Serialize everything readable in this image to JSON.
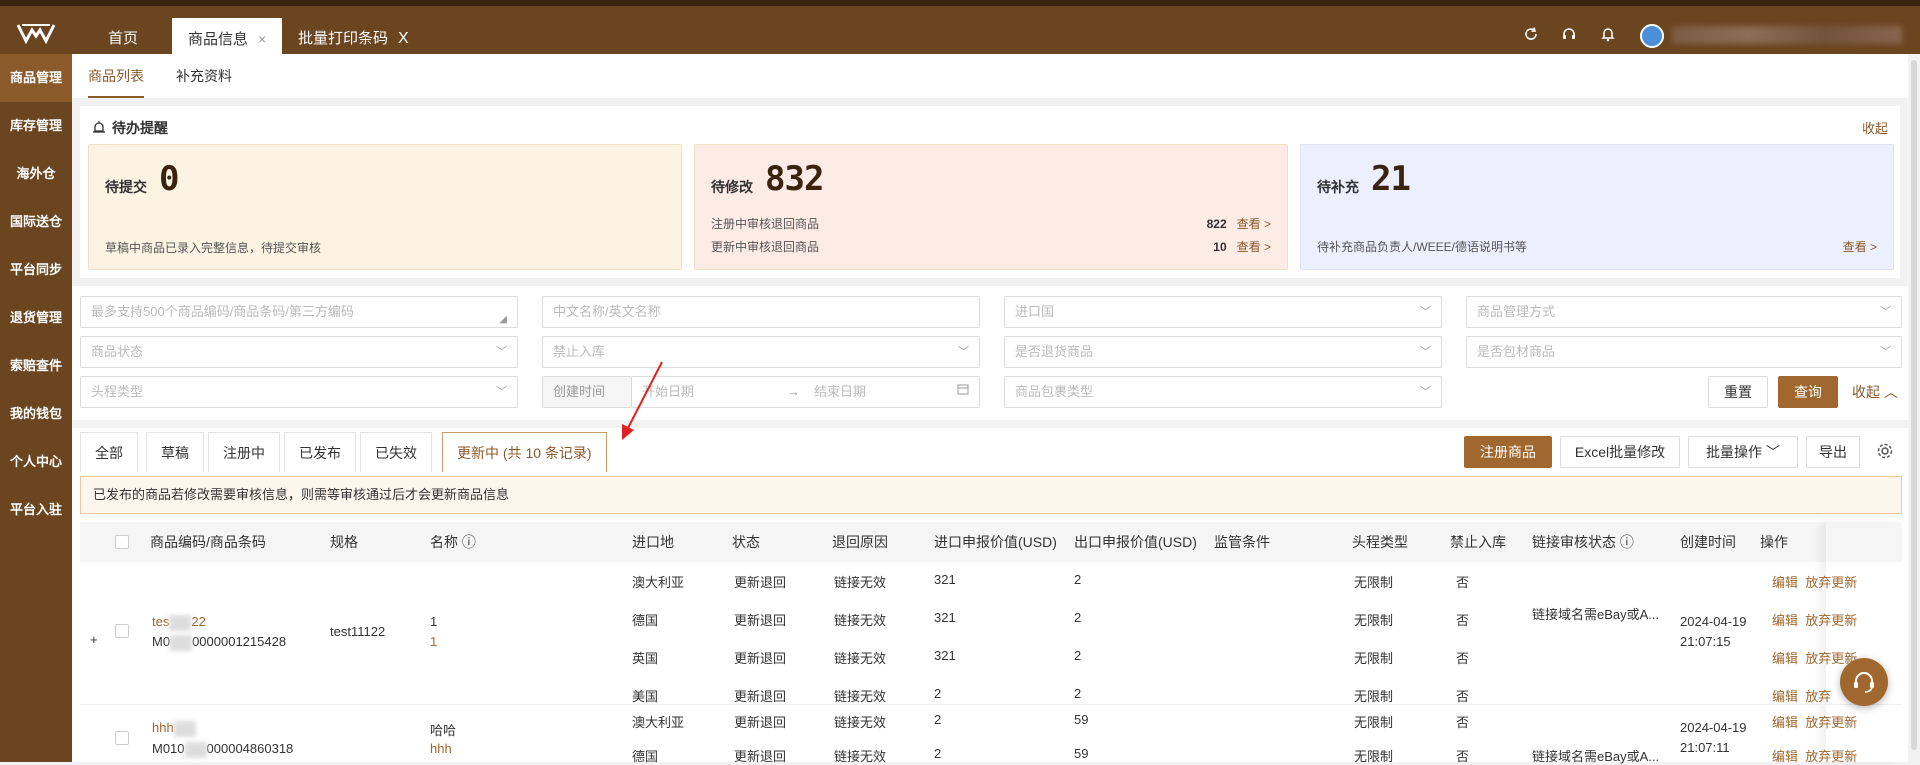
{
  "topbar": {
    "tabs": [
      {
        "label": "首页"
      },
      {
        "label": "商品信息",
        "close": "×"
      },
      {
        "label": "批量打印条码",
        "close": "X"
      }
    ]
  },
  "sidebar": {
    "items": [
      {
        "label": "商品管理",
        "active": true
      },
      {
        "label": "库存管理"
      },
      {
        "label": "海外仓"
      },
      {
        "label": "国际送仓"
      },
      {
        "label": "平台同步"
      },
      {
        "label": "退货管理"
      },
      {
        "label": "索赔查件"
      },
      {
        "label": "我的钱包"
      },
      {
        "label": "个人中心"
      },
      {
        "label": "平台入驻"
      }
    ]
  },
  "subtabs": [
    {
      "label": "商品列表",
      "active": true
    },
    {
      "label": "补充资料"
    }
  ],
  "todo": {
    "title": "待办提醒",
    "collapse": "收起",
    "cards": [
      {
        "label": "待提交",
        "count": "0",
        "desc": "草稿中商品已录入完整信息，待提交审核",
        "bg": "#fdf3e3"
      },
      {
        "label": "待修改",
        "count": "832",
        "bg": "#fdece6",
        "rows": [
          {
            "text": "注册中审核退回商品",
            "count": "822",
            "link": "查看 >"
          },
          {
            "text": "更新中审核退回商品",
            "count": "10",
            "link": "查看 >"
          }
        ]
      },
      {
        "label": "待补充",
        "count": "21",
        "bg": "#eceffd",
        "rows": [
          {
            "text": "待补充商品负责人/WEEE/德语说明书等",
            "count": "",
            "link": "查看 >"
          }
        ]
      }
    ]
  },
  "filters": {
    "code_placeholder": "最多支持500个商品编码/商品条码/第三方编码",
    "name_placeholder": "中文名称/英文名称",
    "import_country": "进口国",
    "manage_mode": "商品管理方式",
    "status": "商品状态",
    "forbid_inbound": "禁止入库",
    "is_return": "是否退货商品",
    "is_packing": "是否包材商品",
    "first_leg": "头程类型",
    "create_time": "创建时间",
    "start_date": "开始日期",
    "end_date": "结束日期",
    "package_type": "商品包裹类型",
    "reset": "重置",
    "search": "查询",
    "collapse": "收起"
  },
  "status_tabs": [
    {
      "label": "全部"
    },
    {
      "label": "草稿"
    },
    {
      "label": "注册中"
    },
    {
      "label": "已发布"
    },
    {
      "label": "已失效"
    },
    {
      "label": "更新中 (共 10 条记录)",
      "active": true
    }
  ],
  "actions": {
    "register": "注册商品",
    "excel": "Excel批量修改",
    "batch": "批量操作",
    "export": "导出"
  },
  "notice": "已发布的商品若修改需要审核信息，则需等审核通过后才会更新商品信息",
  "table": {
    "headers": [
      "商品编码/商品条码",
      "规格",
      "名称",
      "进口地",
      "状态",
      "退回原因",
      "进口申报价值(USD)",
      "出口申报价值(USD)",
      "监管条件",
      "头程类型",
      "禁止入库",
      "链接审核状态",
      "创建时间",
      "操作"
    ],
    "products": [
      {
        "code_a": "tes",
        "code_b": "22",
        "barcode_a": "M0",
        "barcode_b": "0000001215428",
        "spec": "test11122",
        "name": "1",
        "name_en": "1",
        "link_status": "链接域名需eBay或A...",
        "created_date": "2024-04-19",
        "created_time": "21:07:15",
        "rows": [
          {
            "country": "澳大利亚",
            "status": "更新退回",
            "reason": "链接无效",
            "imp": "321",
            "exp": "2",
            "first_leg": "无限制",
            "forbid": "否"
          },
          {
            "country": "德国",
            "status": "更新退回",
            "reason": "链接无效",
            "imp": "321",
            "exp": "2",
            "first_leg": "无限制",
            "forbid": "否"
          },
          {
            "country": "英国",
            "status": "更新退回",
            "reason": "链接无效",
            "imp": "321",
            "exp": "2",
            "first_leg": "无限制",
            "forbid": "否"
          },
          {
            "country": "美国",
            "status": "更新退回",
            "reason": "链接无效",
            "imp": "2",
            "exp": "2",
            "first_leg": "无限制",
            "forbid": "否"
          }
        ]
      },
      {
        "code_a": "hhh",
        "code_b": "",
        "barcode_a": "M010",
        "barcode_b": "000004860318",
        "spec": "",
        "name": "哈哈",
        "name_en": "hhh",
        "link_status": "链接域名需eBay或A...",
        "created_date": "2024-04-19",
        "created_time": "21:07:11",
        "rows": [
          {
            "country": "澳大利亚",
            "status": "更新退回",
            "reason": "链接无效",
            "imp": "2",
            "exp": "59",
            "first_leg": "无限制",
            "forbid": "否"
          },
          {
            "country": "德国",
            "status": "更新退回",
            "reason": "链接无效",
            "imp": "2",
            "exp": "59",
            "first_leg": "无限制",
            "forbid": "否"
          }
        ]
      }
    ],
    "op_edit": "编辑",
    "op_abandon": "放弃更新",
    "op_abandon_short": "放弃"
  }
}
